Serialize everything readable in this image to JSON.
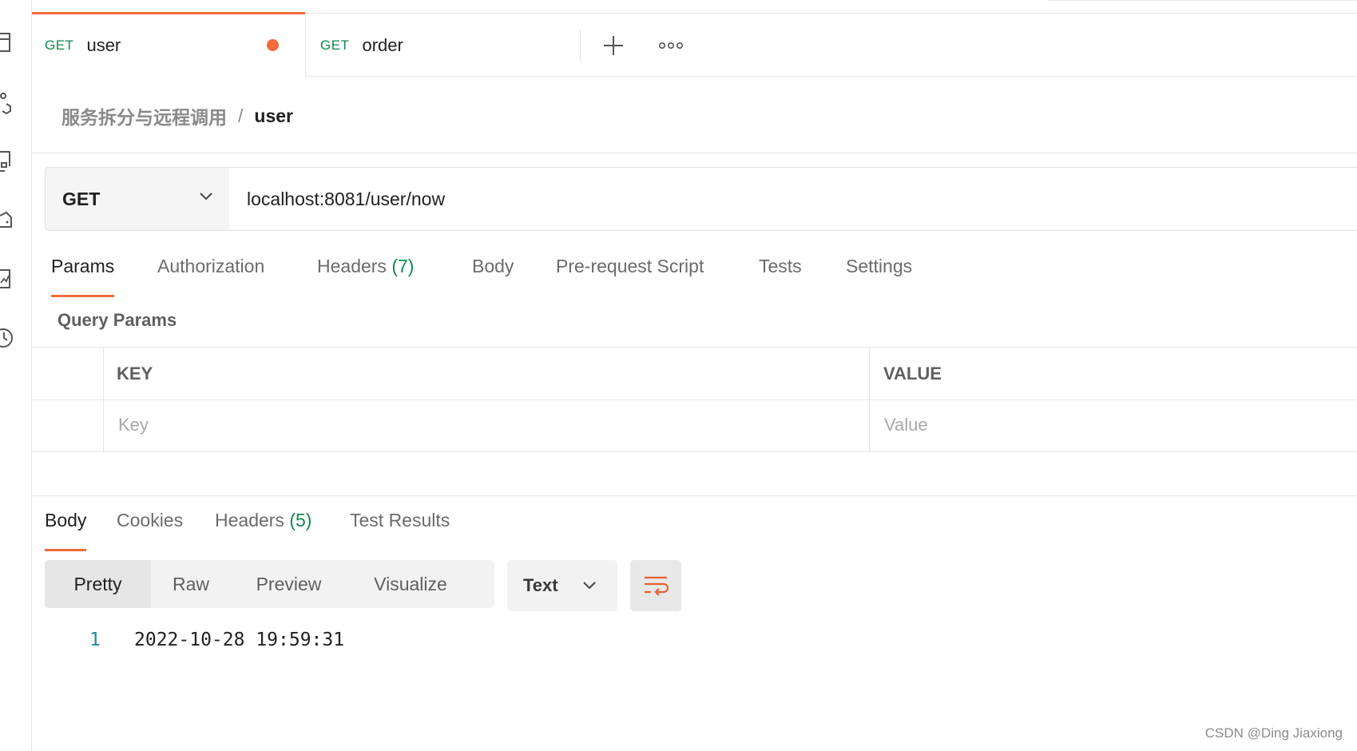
{
  "tabs": [
    {
      "method": "GET",
      "name": "user",
      "unsaved": true,
      "active": true
    },
    {
      "method": "GET",
      "name": "order",
      "unsaved": false,
      "active": false
    }
  ],
  "breadcrumb": {
    "parent": "服务拆分与远程调用",
    "separator": "/",
    "current": "user"
  },
  "request": {
    "method": "GET",
    "url": "localhost:8081/user/now"
  },
  "request_tabs": {
    "params": "Params",
    "authorization": "Authorization",
    "headers": "Headers",
    "headers_count": "(7)",
    "body": "Body",
    "pre_request": "Pre-request Script",
    "tests": "Tests",
    "settings": "Settings",
    "active": "Params"
  },
  "query_params": {
    "title": "Query Params",
    "columns": {
      "key": "KEY",
      "value": "VALUE"
    },
    "placeholders": {
      "key": "Key",
      "value": "Value"
    }
  },
  "response_tabs": {
    "body": "Body",
    "cookies": "Cookies",
    "headers": "Headers",
    "headers_count": "(5)",
    "test_results": "Test Results",
    "active": "Body"
  },
  "view_modes": {
    "pretty": "Pretty",
    "raw": "Raw",
    "preview": "Preview",
    "visualize": "Visualize",
    "active": "Pretty"
  },
  "format": "Text",
  "response_body": {
    "line_number": "1",
    "content": "2022-10-28 19:59:31"
  },
  "watermark": "CSDN @Ding Jiaxiong",
  "colors": {
    "accent": "#f26b3a",
    "method_get": "#0f8a4f",
    "count": "#0f8a4f"
  },
  "rail_icons": [
    "collections-icon",
    "apis-icon",
    "environments-icon",
    "mock-servers-icon",
    "monitors-icon",
    "history-icon"
  ]
}
